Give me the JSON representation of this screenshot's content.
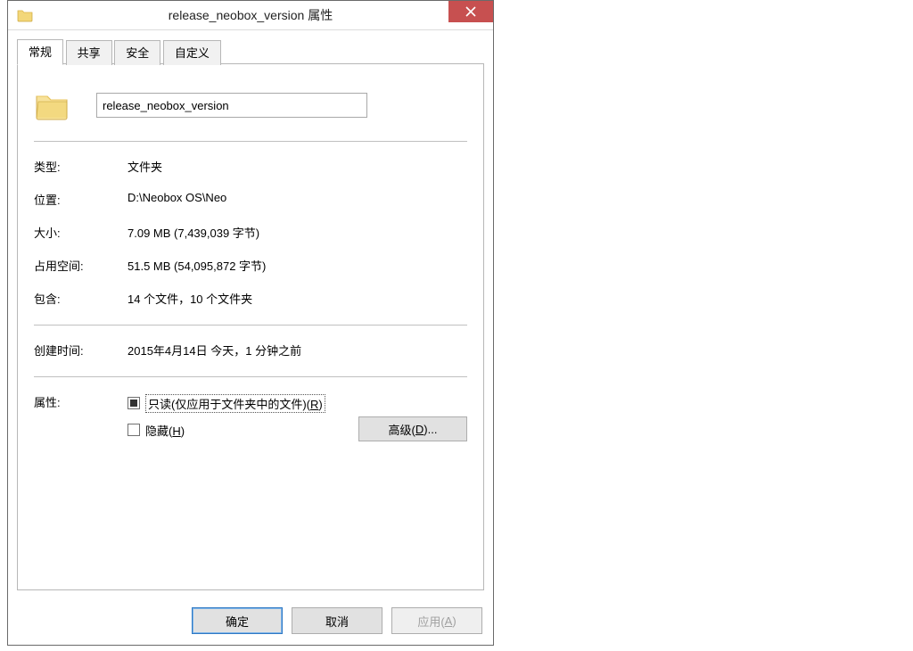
{
  "titlebar": {
    "title": "release_neobox_version 属性"
  },
  "tabs": {
    "general": "常规",
    "share": "共享",
    "security": "安全",
    "custom": "自定义"
  },
  "general": {
    "name_value": "release_neobox_version",
    "type_label": "类型:",
    "type_value": "文件夹",
    "location_label": "位置:",
    "location_value": "D:\\Neobox OS\\Neo",
    "size_label": "大小:",
    "size_value": "7.09 MB (7,439,039 字节)",
    "ondisk_label": "占用空间:",
    "ondisk_value": "51.5 MB (54,095,872 字节)",
    "contains_label": "包含:",
    "contains_value": "14 个文件，10 个文件夹",
    "created_label": "创建时间:",
    "created_value": "2015年4月14日 今天，1 分钟之前",
    "attr_label": "属性:",
    "readonly_prefix": "只读(仅应用于文件夹中的文件)(",
    "readonly_key": "R",
    "readonly_suffix": ")",
    "hidden_prefix": "隐藏(",
    "hidden_key": "H",
    "hidden_suffix": ")",
    "advanced_prefix": "高级(",
    "advanced_key": "D",
    "advanced_suffix": ")..."
  },
  "buttons": {
    "ok": "确定",
    "cancel": "取消",
    "apply_prefix": "应用(",
    "apply_key": "A",
    "apply_suffix": ")"
  }
}
